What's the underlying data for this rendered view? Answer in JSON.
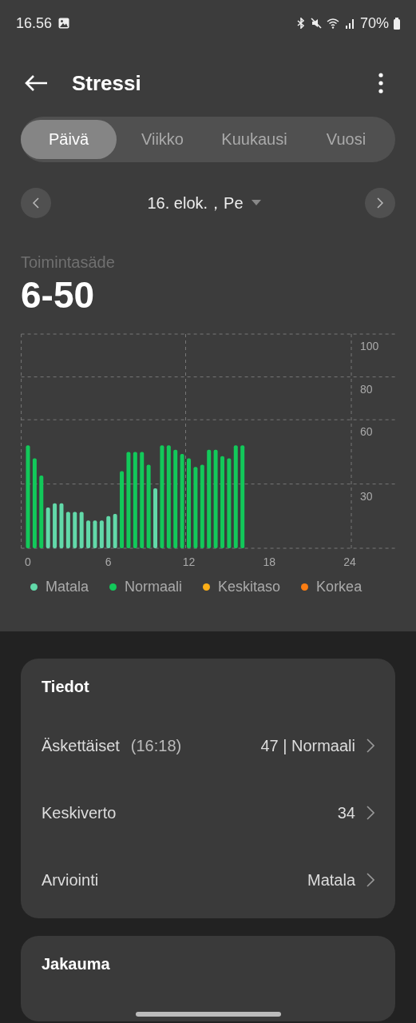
{
  "status_bar": {
    "time": "16.56",
    "battery": "70%"
  },
  "header": {
    "title": "Stressi"
  },
  "tabs": [
    {
      "label": "Päivä",
      "selected": true
    },
    {
      "label": "Viikko",
      "selected": false
    },
    {
      "label": "Kuukausi",
      "selected": false
    },
    {
      "label": "Vuosi",
      "selected": false
    }
  ],
  "date_nav": {
    "date": "16. elok.，Pe"
  },
  "range": {
    "label": "Toimintasäde",
    "value": "6-50"
  },
  "chart": {
    "chart_data": {
      "type": "bar",
      "stacked": true,
      "x": [
        0,
        0.5,
        1,
        1.5,
        2,
        2.5,
        3,
        3.5,
        4,
        4.5,
        5,
        5.5,
        6,
        6.5,
        7,
        7.5,
        8,
        8.5,
        9,
        9.5,
        10,
        10.5,
        11,
        11.5,
        12,
        12.5,
        13,
        13.5,
        14,
        14.5,
        15,
        15.5,
        16
      ],
      "series": [
        {
          "name": "Matala",
          "color": "#62d9a9",
          "values": [
            null,
            null,
            null,
            19,
            21,
            21,
            17,
            17,
            17,
            13,
            13,
            13,
            15,
            16,
            null,
            null,
            null,
            null,
            null,
            28,
            null,
            null,
            null,
            null,
            null,
            null,
            null,
            null,
            null,
            null,
            null,
            null,
            null
          ]
        },
        {
          "name": "Normaali",
          "color": "#12c95a",
          "values": [
            48,
            42,
            34,
            null,
            null,
            null,
            null,
            null,
            null,
            null,
            null,
            null,
            null,
            null,
            36,
            45,
            45,
            45,
            39,
            null,
            48,
            48,
            46,
            44,
            42,
            38,
            39,
            46,
            46,
            43,
            42,
            48,
            48
          ]
        },
        {
          "name": "Keskitaso",
          "color": "#fcae17",
          "values": [
            null,
            null,
            null,
            null,
            null,
            null,
            null,
            null,
            null,
            null,
            null,
            null,
            null,
            null,
            null,
            null,
            null,
            null,
            null,
            null,
            null,
            null,
            null,
            null,
            null,
            null,
            null,
            null,
            null,
            null,
            null,
            null,
            null
          ]
        },
        {
          "name": "Korkea",
          "color": "#fb7d12",
          "values": [
            null,
            null,
            null,
            null,
            null,
            null,
            null,
            null,
            null,
            null,
            null,
            null,
            null,
            null,
            null,
            null,
            null,
            null,
            null,
            null,
            null,
            null,
            null,
            null,
            null,
            null,
            null,
            null,
            null,
            null,
            null,
            null,
            null
          ]
        }
      ],
      "grid": true,
      "xlim": [
        -0.5,
        27.5
      ],
      "ylim": [
        0,
        100
      ],
      "xticks": [
        0,
        6,
        12,
        18,
        24
      ],
      "yticks": [
        30,
        60,
        80,
        100
      ]
    }
  },
  "details": {
    "title": "Tiedot",
    "rows": [
      {
        "label": "Äskettäiset",
        "time": "(16:18)",
        "value": "47 | Normaali"
      },
      {
        "label": "Keskiverto",
        "value": "34"
      },
      {
        "label": "Arviointi",
        "value": "Matala"
      }
    ]
  },
  "distribution": {
    "title": "Jakauma"
  }
}
